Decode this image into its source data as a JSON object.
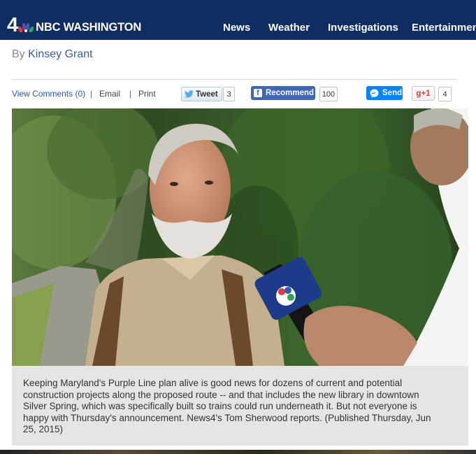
{
  "header": {
    "logo_number": "4",
    "logo_name": "NBC WASHINGTON",
    "nav": [
      "News",
      "Weather",
      "Investigations",
      "Entertainment"
    ]
  },
  "article": {
    "byline_prefix": "By",
    "author": "Kinsey Grant"
  },
  "tools": {
    "comments": "View Comments (0)",
    "separator": "|",
    "email": "Email",
    "print": "Print"
  },
  "social": {
    "tweet_label": "Tweet",
    "tweet_count": "3",
    "recommend_label": "Recommend",
    "recommend_count": "100",
    "send_label": "Send",
    "gplus_label": "g+1",
    "gplus_count": "4"
  },
  "media": {
    "caption": "Keeping Maryland's Purple Line plan alive is good news for dozens of current and potential construction projects along the proposed route -- and that includes the new library in downtown Silver Spring, which was specifically built so trains could run underneath it. But not everyone is happy with Thursday's announcement. News4's Tom Sherwood reports. (Published Thursday, Jun 25, 2015)"
  },
  "colors": {
    "header_bg": "#0f2d63",
    "link_blue": "#2b5aa3",
    "facebook": "#4267b2",
    "messenger": "#0084ff",
    "gplus": "#d73d32",
    "caption_bg": "#e5e5e5"
  },
  "icons": [
    "nbc-peacock-icon",
    "twitter-bird-icon",
    "facebook-icon",
    "messenger-icon"
  ]
}
